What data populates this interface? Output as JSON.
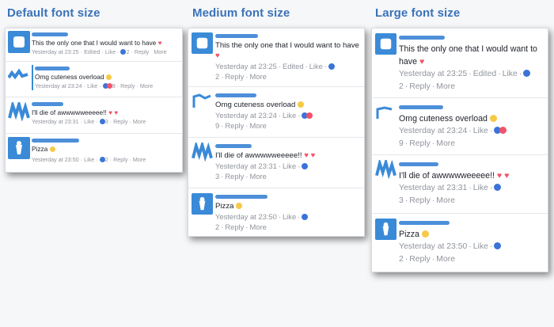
{
  "columns": [
    {
      "title": "Default font size",
      "comments": [
        {
          "text": "This the only one that I would want to have",
          "emoji": "heart",
          "time": "Yesterday at 23:25",
          "edited": "Edited",
          "like": "Like",
          "count": "2",
          "reactions": [
            "like"
          ],
          "reply": "Reply",
          "more": "More"
        },
        {
          "text": "Omg cuteness overload",
          "emoji": "heart-eyes",
          "time": "Yesterday at 23:24",
          "like": "Like",
          "count": "9",
          "reactions": [
            "like",
            "love"
          ],
          "reply": "Reply",
          "more": "More"
        },
        {
          "text": "I'll die of awwwwweeeee!!",
          "emoji": "two-hearts",
          "time": "Yesterday at 23:31",
          "like": "Like",
          "count": "3",
          "reactions": [
            "like"
          ],
          "reply": "Reply",
          "more": "More"
        },
        {
          "text": "Pizza",
          "emoji": "smile",
          "time": "Yesterday at 23:50",
          "like": "Like",
          "count": "2",
          "reactions": [
            "like"
          ],
          "reply": "Reply",
          "more": "More"
        }
      ]
    },
    {
      "title": "Medium font size",
      "comments": [
        {
          "text": "This the only one that I would want to have",
          "emoji": "heart",
          "time": "Yesterday at 23:25",
          "edited": "Edited",
          "like": "Like",
          "count": "2",
          "reactions": [
            "like"
          ],
          "reply": "Reply",
          "more": "More"
        },
        {
          "text": "Omg cuteness overload",
          "emoji": "heart-eyes",
          "time": "Yesterday at 23:24",
          "like": "Like",
          "count": "9",
          "reactions": [
            "like",
            "love"
          ],
          "reply": "Reply",
          "more": "More"
        },
        {
          "text": "I'll die of awwwwweeeee!!",
          "emoji": "two-hearts",
          "time": "Yesterday at 23:31",
          "like": "Like",
          "count": "3",
          "reactions": [
            "like"
          ],
          "reply": "Reply",
          "more": "More"
        },
        {
          "text": "Pizza",
          "emoji": "smile",
          "time": "Yesterday at 23:50",
          "like": "Like",
          "count": "2",
          "reactions": [
            "like"
          ],
          "reply": "Reply",
          "more": "More"
        }
      ]
    },
    {
      "title": "Large font size",
      "comments": [
        {
          "text": "This the only one that I would want to have",
          "emoji": "heart",
          "time": "Yesterday at 23:25",
          "edited": "Edited",
          "like": "Like",
          "count": "2",
          "reactions": [
            "like"
          ],
          "reply": "Reply",
          "more": "More"
        },
        {
          "text": "Omg cuteness overload",
          "emoji": "heart-eyes",
          "time": "Yesterday at 23:24",
          "like": "Like",
          "count": "9",
          "reactions": [
            "like",
            "love"
          ],
          "reply": "Reply",
          "more": "More"
        },
        {
          "text": "I'll die of awwwwweeeee!!",
          "emoji": "two-hearts",
          "time": "Yesterday at 23:31",
          "like": "Like",
          "count": "3",
          "reactions": [
            "like"
          ],
          "reply": "Reply",
          "more": "More"
        },
        {
          "text": "Pizza",
          "emoji": "smile",
          "time": "Yesterday at 23:50",
          "like": "Like",
          "count": "2",
          "reactions": [
            "like"
          ],
          "reply": "Reply",
          "more": "More"
        }
      ]
    }
  ],
  "colors": {
    "title": "#3b73b9",
    "author": "#4d8fd9",
    "meta": "#90949c",
    "like_reaction": "#3b73d8",
    "love_reaction": "#f25268",
    "heart": "#f25268"
  }
}
